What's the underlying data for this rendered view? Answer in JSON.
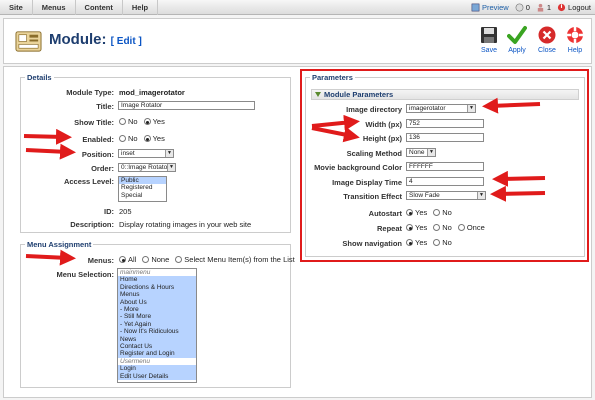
{
  "topbar": {
    "menu": [
      "Site",
      "Menus",
      "Content",
      "Help"
    ],
    "preview": "Preview",
    "messages": "0",
    "users": "1",
    "logout": "Logout"
  },
  "header": {
    "title": "Module:",
    "edit": "[ Edit ]",
    "buttons": {
      "save": "Save",
      "apply": "Apply",
      "close": "Close",
      "help": "Help"
    }
  },
  "details": {
    "legend": "Details",
    "module_type_label": "Module Type:",
    "module_type_value": "mod_imagerotator",
    "title_label": "Title:",
    "title_value": "Image Rotator",
    "show_title_label": "Show Title:",
    "enabled_label": "Enabled:",
    "position_label": "Position:",
    "position_value": "inset",
    "order_label": "Order:",
    "order_value": "0::Image Rotator",
    "access_label": "Access Level:",
    "access_options": [
      "Public",
      "Registered",
      "Special"
    ],
    "id_label": "ID:",
    "id_value": "205",
    "description_label": "Description:",
    "description_value": "Display rotating images in your web site",
    "no": "No",
    "yes": "Yes"
  },
  "menu_assignment": {
    "legend": "Menu Assignment",
    "menus_label": "Menus:",
    "all": "All",
    "none": "None",
    "select": "Select Menu Item(s) from the List",
    "selection_label": "Menu Selection:",
    "items": [
      {
        "text": "mainmenu",
        "group": true
      },
      {
        "text": "Home"
      },
      {
        "text": "Directions & Hours"
      },
      {
        "text": "Menus"
      },
      {
        "text": "About Us"
      },
      {
        "text": " - More"
      },
      {
        "text": " - Still More"
      },
      {
        "text": " - Yet Again"
      },
      {
        "text": " - Now It's Ridiculous"
      },
      {
        "text": "News"
      },
      {
        "text": "Contact Us"
      },
      {
        "text": "Register and Login"
      },
      {
        "text": "Usermenu",
        "group": true
      },
      {
        "text": "Login"
      },
      {
        "text": "Edit User Details"
      }
    ]
  },
  "parameters": {
    "legend": "Parameters",
    "subhead": "Module Parameters",
    "image_dir_label": "Image directory",
    "image_dir_value": "imagerotator",
    "width_label": "Width (px)",
    "width_value": "752",
    "height_label": "Height (px)",
    "height_value": "136",
    "scaling_label": "Scaling Method",
    "scaling_value": "None",
    "bgcolor_label": "Movie background Color",
    "bgcolor_value": "FFFFFF",
    "display_time_label": "Image Display Time",
    "display_time_value": "4",
    "transition_label": "Transition Effect",
    "transition_value": "Slow Fade",
    "autostart_label": "Autostart",
    "repeat_label": "Repeat",
    "once": "Once",
    "shownav_label": "Show navigation",
    "yes": "Yes",
    "no": "No"
  },
  "colors": {
    "annotation_red": "#e01b1b",
    "title_blue": "#1e3e6f",
    "link_blue": "#0b55c4"
  }
}
